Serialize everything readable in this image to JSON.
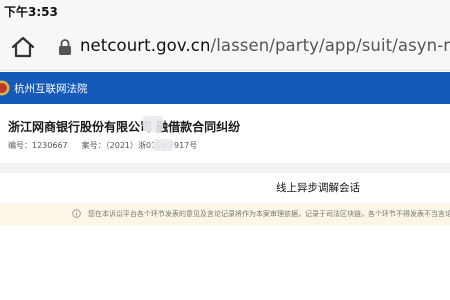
{
  "status_bar": {
    "time": "下午3:53"
  },
  "browser": {
    "url_domain": "netcourt.gov.cn",
    "url_path": "/lassen/party/app/suit/asyn-mediate?"
  },
  "court": {
    "name": "杭州互联网法院"
  },
  "case": {
    "title": "浙江网商银行股份有限公司 融借款合同纠纷",
    "number_label": "编号：",
    "number": "1230667",
    "case_no_label": "案号：",
    "case_no": "（2021）浙0192 7917号"
  },
  "section": {
    "title": "线上异步调解会话"
  },
  "notice": {
    "text": "您在本诉讼平台各个环节发表的意见及言论记录将作为本案审理依据，记录于司法区块链，各个环节不得发表不当言论"
  },
  "colors": {
    "header_bg": "#1559b9",
    "notice_bg": "#fbf6e6"
  },
  "icons": [
    "home-icon",
    "lock-icon",
    "court-emblem-icon",
    "info-icon"
  ]
}
